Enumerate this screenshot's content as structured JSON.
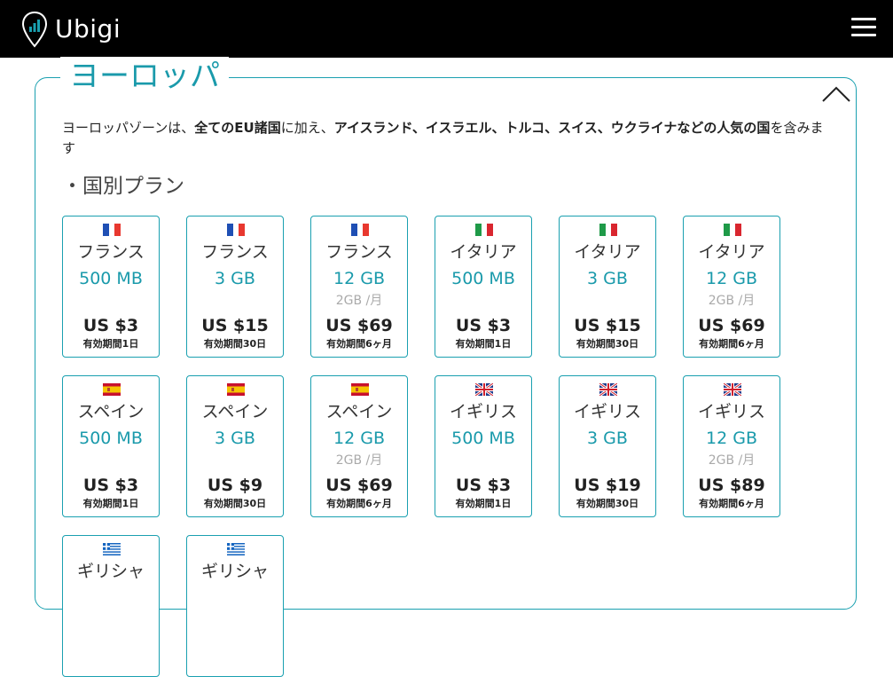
{
  "header": {
    "logo_text": "Ubigi"
  },
  "section": {
    "title": "ヨーロッパ",
    "intro_parts": [
      {
        "text": "ヨーロッパゾーンは、",
        "bold": false
      },
      {
        "text": "全てのEU諸国",
        "bold": true
      },
      {
        "text": "に加え、",
        "bold": false
      },
      {
        "text": "アイスランド、イスラエル、トルコ、スイス、ウクライナなどの人気の国",
        "bold": true
      },
      {
        "text": "を含みます",
        "bold": false
      }
    ],
    "subheading": "・国別プラン"
  },
  "plans": [
    {
      "flag": "fr",
      "country": "フランス",
      "data": "500 MB",
      "per": "",
      "price": "US $3",
      "validity": "有効期間1日"
    },
    {
      "flag": "fr",
      "country": "フランス",
      "data": "3 GB",
      "per": "",
      "price": "US $15",
      "validity": "有効期間30日"
    },
    {
      "flag": "fr",
      "country": "フランス",
      "data": "12 GB",
      "per": "2GB /月",
      "price": "US $69",
      "validity": "有効期間6ヶ月"
    },
    {
      "flag": "it",
      "country": "イタリア",
      "data": "500 MB",
      "per": "",
      "price": "US $3",
      "validity": "有効期間1日"
    },
    {
      "flag": "it",
      "country": "イタリア",
      "data": "3 GB",
      "per": "",
      "price": "US $15",
      "validity": "有効期間30日"
    },
    {
      "flag": "it",
      "country": "イタリア",
      "data": "12 GB",
      "per": "2GB /月",
      "price": "US $69",
      "validity": "有効期間6ヶ月"
    },
    {
      "flag": "es",
      "country": "スペイン",
      "data": "500 MB",
      "per": "",
      "price": "US $3",
      "validity": "有効期間1日"
    },
    {
      "flag": "es",
      "country": "スペイン",
      "data": "3 GB",
      "per": "",
      "price": "US $9",
      "validity": "有効期間30日"
    },
    {
      "flag": "es",
      "country": "スペイン",
      "data": "12 GB",
      "per": "2GB /月",
      "price": "US $69",
      "validity": "有効期間6ヶ月"
    },
    {
      "flag": "gb",
      "country": "イギリス",
      "data": "500 MB",
      "per": "",
      "price": "US $3",
      "validity": "有効期間1日"
    },
    {
      "flag": "gb",
      "country": "イギリス",
      "data": "3 GB",
      "per": "",
      "price": "US $19",
      "validity": "有効期間30日"
    },
    {
      "flag": "gb",
      "country": "イギリス",
      "data": "12 GB",
      "per": "2GB /月",
      "price": "US $89",
      "validity": "有効期間6ヶ月"
    },
    {
      "flag": "gr",
      "country": "ギリシャ",
      "data": "",
      "per": "",
      "price": "",
      "validity": ""
    },
    {
      "flag": "gr",
      "country": "ギリシャ",
      "data": "",
      "per": "",
      "price": "",
      "validity": ""
    }
  ],
  "colors": {
    "accent": "#1a9aab",
    "header_bg": "#000000"
  }
}
